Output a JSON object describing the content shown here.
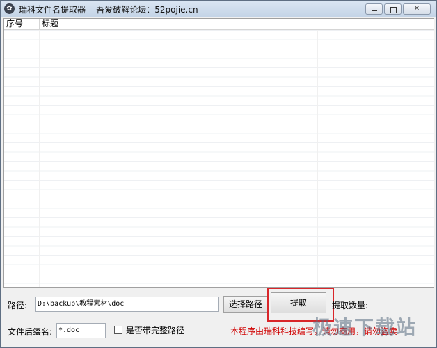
{
  "window": {
    "title": "瑞科文件名提取器    吾爱破解论坛：52pojie.cn",
    "icon": "app-icon",
    "controls": [
      "minimize-icon",
      "maximize-icon",
      "close-icon"
    ]
  },
  "list": {
    "columns": [
      "序号",
      "标题"
    ],
    "rows": []
  },
  "path": {
    "label": "路径:",
    "value": "D:\\backup\\教程素材\\doc"
  },
  "buttons": {
    "select_path": "选择路径",
    "extract": "提取"
  },
  "count_label": "提取数量:",
  "suffix": {
    "label": "文件后缀名:",
    "value": "*.doc"
  },
  "full_path": {
    "label": "是否带完整路径",
    "checked": false
  },
  "footer_note": "本程序由瑞科科技编写，请勿商用，请勿盗卖",
  "watermark": "极速下载站",
  "colors": {
    "highlight": "#d9262a",
    "footer_text": "#d00000"
  }
}
